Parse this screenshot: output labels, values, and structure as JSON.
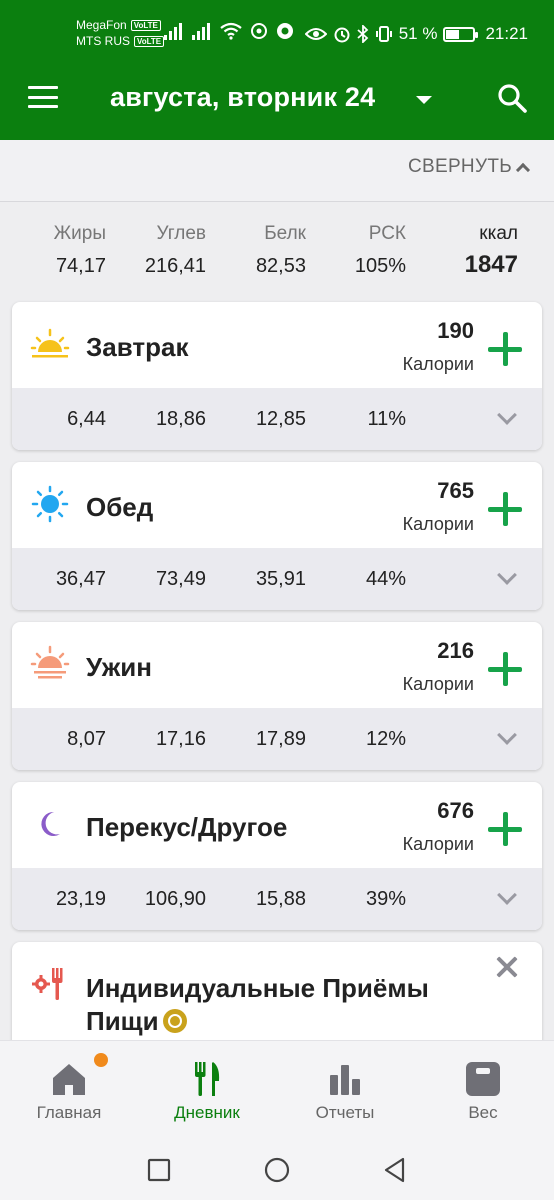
{
  "status_bar": {
    "carrier1": "MegaFon",
    "carrier2": "MTS RUS",
    "volte": "VoLTE",
    "battery": "51 %",
    "battery_level": 0.51,
    "time": "21:21"
  },
  "app_bar": {
    "title": "августа, вторник 24"
  },
  "collapse": {
    "label": "СВЕРНУТЬ"
  },
  "totals": {
    "fat": {
      "label": "Жиры",
      "value": "74,17"
    },
    "carbs": {
      "label": "Углев",
      "value": "216,41"
    },
    "protein": {
      "label": "Белк",
      "value": "82,53"
    },
    "rdi": {
      "label": "РСК",
      "value": "105%"
    },
    "kcal": {
      "label": "ккал",
      "value": "1847"
    }
  },
  "meals": [
    {
      "name": "Завтрак",
      "calories": "190",
      "calories_label": "Калории",
      "fat": "6,44",
      "carbs": "18,86",
      "protein": "12,85",
      "rdi": "11%"
    },
    {
      "name": "Обед",
      "calories": "765",
      "calories_label": "Калории",
      "fat": "36,47",
      "carbs": "73,49",
      "protein": "35,91",
      "rdi": "44%"
    },
    {
      "name": "Ужин",
      "calories": "216",
      "calories_label": "Калории",
      "fat": "8,07",
      "carbs": "17,16",
      "protein": "17,89",
      "rdi": "12%"
    },
    {
      "name": "Перекус/Другое",
      "calories": "676",
      "calories_label": "Калории",
      "fat": "23,19",
      "carbs": "106,90",
      "protein": "15,88",
      "rdi": "39%"
    }
  ],
  "custom_meals": {
    "title_line1": "Индивидуальные Приёмы",
    "title_line2": "Пищи"
  },
  "bottom_nav": {
    "home": "Главная",
    "diary": "Дневник",
    "reports": "Отчеты",
    "weight": "Вес"
  },
  "colors": {
    "primary": "#0b7f0f",
    "accent_plus": "#17a34a",
    "notification": "#f08a1c"
  }
}
